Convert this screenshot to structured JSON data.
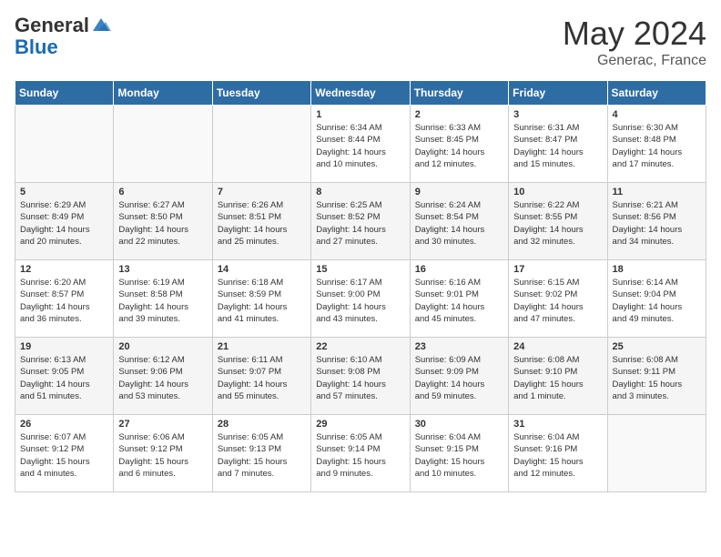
{
  "header": {
    "logo_general": "General",
    "logo_blue": "Blue",
    "month_year": "May 2024",
    "location": "Generac, France"
  },
  "weekdays": [
    "Sunday",
    "Monday",
    "Tuesday",
    "Wednesday",
    "Thursday",
    "Friday",
    "Saturday"
  ],
  "weeks": [
    [
      {
        "day": "",
        "info": ""
      },
      {
        "day": "",
        "info": ""
      },
      {
        "day": "",
        "info": ""
      },
      {
        "day": "1",
        "info": "Sunrise: 6:34 AM\nSunset: 8:44 PM\nDaylight: 14 hours\nand 10 minutes."
      },
      {
        "day": "2",
        "info": "Sunrise: 6:33 AM\nSunset: 8:45 PM\nDaylight: 14 hours\nand 12 minutes."
      },
      {
        "day": "3",
        "info": "Sunrise: 6:31 AM\nSunset: 8:47 PM\nDaylight: 14 hours\nand 15 minutes."
      },
      {
        "day": "4",
        "info": "Sunrise: 6:30 AM\nSunset: 8:48 PM\nDaylight: 14 hours\nand 17 minutes."
      }
    ],
    [
      {
        "day": "5",
        "info": "Sunrise: 6:29 AM\nSunset: 8:49 PM\nDaylight: 14 hours\nand 20 minutes."
      },
      {
        "day": "6",
        "info": "Sunrise: 6:27 AM\nSunset: 8:50 PM\nDaylight: 14 hours\nand 22 minutes."
      },
      {
        "day": "7",
        "info": "Sunrise: 6:26 AM\nSunset: 8:51 PM\nDaylight: 14 hours\nand 25 minutes."
      },
      {
        "day": "8",
        "info": "Sunrise: 6:25 AM\nSunset: 8:52 PM\nDaylight: 14 hours\nand 27 minutes."
      },
      {
        "day": "9",
        "info": "Sunrise: 6:24 AM\nSunset: 8:54 PM\nDaylight: 14 hours\nand 30 minutes."
      },
      {
        "day": "10",
        "info": "Sunrise: 6:22 AM\nSunset: 8:55 PM\nDaylight: 14 hours\nand 32 minutes."
      },
      {
        "day": "11",
        "info": "Sunrise: 6:21 AM\nSunset: 8:56 PM\nDaylight: 14 hours\nand 34 minutes."
      }
    ],
    [
      {
        "day": "12",
        "info": "Sunrise: 6:20 AM\nSunset: 8:57 PM\nDaylight: 14 hours\nand 36 minutes."
      },
      {
        "day": "13",
        "info": "Sunrise: 6:19 AM\nSunset: 8:58 PM\nDaylight: 14 hours\nand 39 minutes."
      },
      {
        "day": "14",
        "info": "Sunrise: 6:18 AM\nSunset: 8:59 PM\nDaylight: 14 hours\nand 41 minutes."
      },
      {
        "day": "15",
        "info": "Sunrise: 6:17 AM\nSunset: 9:00 PM\nDaylight: 14 hours\nand 43 minutes."
      },
      {
        "day": "16",
        "info": "Sunrise: 6:16 AM\nSunset: 9:01 PM\nDaylight: 14 hours\nand 45 minutes."
      },
      {
        "day": "17",
        "info": "Sunrise: 6:15 AM\nSunset: 9:02 PM\nDaylight: 14 hours\nand 47 minutes."
      },
      {
        "day": "18",
        "info": "Sunrise: 6:14 AM\nSunset: 9:04 PM\nDaylight: 14 hours\nand 49 minutes."
      }
    ],
    [
      {
        "day": "19",
        "info": "Sunrise: 6:13 AM\nSunset: 9:05 PM\nDaylight: 14 hours\nand 51 minutes."
      },
      {
        "day": "20",
        "info": "Sunrise: 6:12 AM\nSunset: 9:06 PM\nDaylight: 14 hours\nand 53 minutes."
      },
      {
        "day": "21",
        "info": "Sunrise: 6:11 AM\nSunset: 9:07 PM\nDaylight: 14 hours\nand 55 minutes."
      },
      {
        "day": "22",
        "info": "Sunrise: 6:10 AM\nSunset: 9:08 PM\nDaylight: 14 hours\nand 57 minutes."
      },
      {
        "day": "23",
        "info": "Sunrise: 6:09 AM\nSunset: 9:09 PM\nDaylight: 14 hours\nand 59 minutes."
      },
      {
        "day": "24",
        "info": "Sunrise: 6:08 AM\nSunset: 9:10 PM\nDaylight: 15 hours\nand 1 minute."
      },
      {
        "day": "25",
        "info": "Sunrise: 6:08 AM\nSunset: 9:11 PM\nDaylight: 15 hours\nand 3 minutes."
      }
    ],
    [
      {
        "day": "26",
        "info": "Sunrise: 6:07 AM\nSunset: 9:12 PM\nDaylight: 15 hours\nand 4 minutes."
      },
      {
        "day": "27",
        "info": "Sunrise: 6:06 AM\nSunset: 9:12 PM\nDaylight: 15 hours\nand 6 minutes."
      },
      {
        "day": "28",
        "info": "Sunrise: 6:05 AM\nSunset: 9:13 PM\nDaylight: 15 hours\nand 7 minutes."
      },
      {
        "day": "29",
        "info": "Sunrise: 6:05 AM\nSunset: 9:14 PM\nDaylight: 15 hours\nand 9 minutes."
      },
      {
        "day": "30",
        "info": "Sunrise: 6:04 AM\nSunset: 9:15 PM\nDaylight: 15 hours\nand 10 minutes."
      },
      {
        "day": "31",
        "info": "Sunrise: 6:04 AM\nSunset: 9:16 PM\nDaylight: 15 hours\nand 12 minutes."
      },
      {
        "day": "",
        "info": ""
      }
    ]
  ]
}
